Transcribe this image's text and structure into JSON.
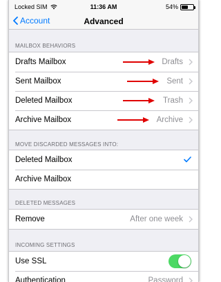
{
  "status": {
    "carrier": "Locked SIM",
    "time": "11:36 AM",
    "battery_text": "54%",
    "battery_level": 0.54
  },
  "nav": {
    "back_label": "Account",
    "title": "Advanced"
  },
  "mailbox_behaviors": {
    "header": "MAILBOX BEHAVIORS",
    "rows": [
      {
        "label": "Drafts Mailbox",
        "value": "Drafts"
      },
      {
        "label": "Sent Mailbox",
        "value": "Sent"
      },
      {
        "label": "Deleted Mailbox",
        "value": "Trash"
      },
      {
        "label": "Archive Mailbox",
        "value": "Archive"
      }
    ]
  },
  "discarded": {
    "header": "MOVE DISCARDED MESSAGES INTO:",
    "rows": [
      {
        "label": "Deleted Mailbox",
        "selected": true
      },
      {
        "label": "Archive Mailbox",
        "selected": false
      }
    ]
  },
  "deleted_messages": {
    "header": "DELETED MESSAGES",
    "remove_label": "Remove",
    "remove_value": "After one week"
  },
  "incoming": {
    "header": "INCOMING SETTINGS",
    "ssl_label": "Use SSL",
    "ssl_on": true,
    "auth_label": "Authentication",
    "auth_value": "Password"
  },
  "colors": {
    "accent": "#007aff",
    "toggle_on": "#4cd964",
    "annotation_arrow": "#e00000"
  }
}
